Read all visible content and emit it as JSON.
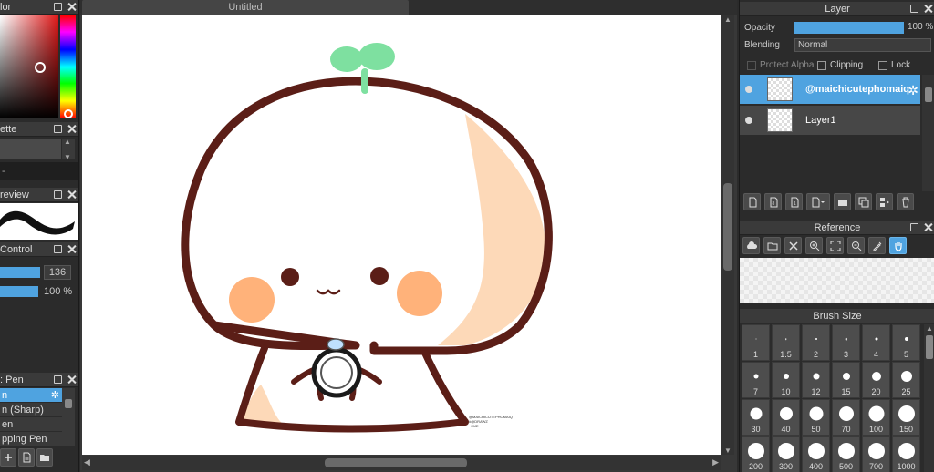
{
  "color_panel": {
    "title": "lor"
  },
  "palette_panel": {
    "title": "ette",
    "row_text": "-"
  },
  "brush_preview_panel": {
    "title": "review"
  },
  "brush_control_panel": {
    "title": "Control",
    "size_value": "136",
    "opacity_value": "100 %",
    "size_fraction": 0.88,
    "opacity_fraction": 1.0
  },
  "brush_list_panel": {
    "title": ": Pen",
    "items": [
      "n",
      "n (Sharp)",
      "en",
      "pping Pen"
    ]
  },
  "document": {
    "tab_title": "Untitled",
    "signature_text": "@MAICHICUTEPHOMAIQ\n#@DRAWZ\n~2ME~"
  },
  "layer_panel": {
    "title": "Layer",
    "opacity_label": "Opacity",
    "opacity_value": "100 %",
    "opacity_fraction": 1.0,
    "blending_label": "Blending",
    "blending_value": "Normal",
    "protect_alpha_label": "Protect Alpha",
    "clipping_label": "Clipping",
    "lock_label": "Lock",
    "layers": [
      {
        "name": "@maichicutephomaiq",
        "selected": true
      },
      {
        "name": "Layer1",
        "selected": false
      }
    ]
  },
  "reference_panel": {
    "title": "Reference"
  },
  "brush_size_panel": {
    "title": "Brush Size",
    "sizes": [
      "1",
      "1.5",
      "2",
      "3",
      "4",
      "5",
      "7",
      "10",
      "12",
      "15",
      "20",
      "25",
      "30",
      "40",
      "50",
      "70",
      "100",
      "150",
      "200",
      "300",
      "400",
      "500",
      "700",
      "1000"
    ]
  },
  "colors": {
    "accent": "#4fa3e0",
    "panel_bg": "#2b2b2b",
    "header_bg": "#3a3a3a"
  }
}
